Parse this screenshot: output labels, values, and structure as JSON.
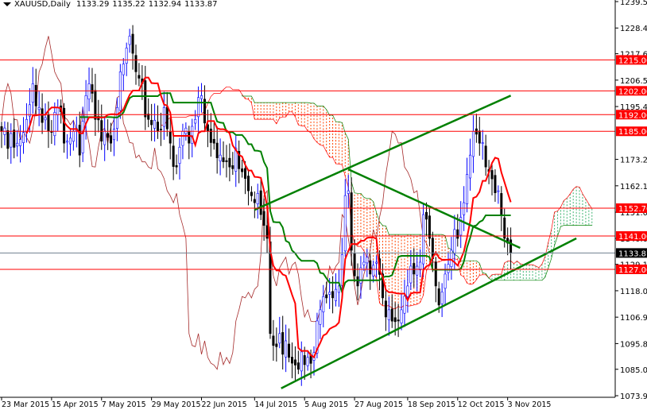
{
  "header": {
    "symbol": "XAUUSD,Daily",
    "open": "1133.29",
    "high": "1135.22",
    "low": "1132.94",
    "close": "1133.87"
  },
  "chart_data": {
    "type": "candlestick",
    "title": "XAUUSD,Daily",
    "ylim": [
      1073.9,
      1239.5
    ],
    "y_ticks": [
      "1239.50",
      "1228.40",
      "1217.60",
      "1206.50",
      "1195.40",
      "1173.20",
      "1162.10",
      "1151.00",
      "1140.00",
      "1129.10",
      "1118.00",
      "1106.90",
      "1095.80",
      "1085.00",
      "1073.90"
    ],
    "x_ticks": [
      {
        "bar": 0,
        "label": "23 Mar 2015"
      },
      {
        "bar": 16,
        "label": "15 Apr 2015"
      },
      {
        "bar": 32,
        "label": "7 May 2015"
      },
      {
        "bar": 48,
        "label": "29 May 2015"
      },
      {
        "bar": 64,
        "label": "22 Jun 2015"
      },
      {
        "bar": 81,
        "label": "14 Jul 2015"
      },
      {
        "bar": 97,
        "label": "5 Aug 2015"
      },
      {
        "bar": 113,
        "label": "27 Aug 2015"
      },
      {
        "bar": 130,
        "label": "18 Sep 2015"
      },
      {
        "bar": 146,
        "label": "12 Oct 2015"
      },
      {
        "bar": 162,
        "label": "3 Nov 2015"
      }
    ],
    "price_keypoints": [
      [
        0,
        1185
      ],
      [
        5,
        1180
      ],
      [
        8,
        1190
      ],
      [
        10,
        1205
      ],
      [
        12,
        1195
      ],
      [
        15,
        1185
      ],
      [
        18,
        1195
      ],
      [
        20,
        1180
      ],
      [
        23,
        1185
      ],
      [
        25,
        1175
      ],
      [
        27,
        1200
      ],
      [
        28,
        1205
      ],
      [
        30,
        1190
      ],
      [
        33,
        1185
      ],
      [
        35,
        1180
      ],
      [
        37,
        1195
      ],
      [
        38,
        1210
      ],
      [
        40,
        1220
      ],
      [
        41,
        1225
      ],
      [
        43,
        1210
      ],
      [
        45,
        1205
      ],
      [
        47,
        1190
      ],
      [
        50,
        1185
      ],
      [
        52,
        1195
      ],
      [
        54,
        1180
      ],
      [
        56,
        1170
      ],
      [
        58,
        1185
      ],
      [
        60,
        1180
      ],
      [
        62,
        1190
      ],
      [
        64,
        1200
      ],
      [
        66,
        1185
      ],
      [
        68,
        1180
      ],
      [
        70,
        1175
      ],
      [
        73,
        1170
      ],
      [
        75,
        1178
      ],
      [
        77,
        1168
      ],
      [
        79,
        1160
      ],
      [
        81,
        1155
      ],
      [
        83,
        1150
      ],
      [
        85,
        1140
      ],
      [
        86,
        1100
      ],
      [
        87,
        1095
      ],
      [
        89,
        1100
      ],
      [
        92,
        1090
      ],
      [
        95,
        1085
      ],
      [
        98,
        1090
      ],
      [
        100,
        1092
      ],
      [
        102,
        1110
      ],
      [
        104,
        1115
      ],
      [
        106,
        1115
      ],
      [
        108,
        1120
      ],
      [
        110,
        1158
      ],
      [
        111,
        1160
      ],
      [
        112,
        1135
      ],
      [
        114,
        1120
      ],
      [
        116,
        1130
      ],
      [
        118,
        1125
      ],
      [
        120,
        1130
      ],
      [
        122,
        1115
      ],
      [
        124,
        1110
      ],
      [
        126,
        1105
      ],
      [
        128,
        1110
      ],
      [
        130,
        1120
      ],
      [
        132,
        1125
      ],
      [
        134,
        1130
      ],
      [
        135,
        1150
      ],
      [
        137,
        1140
      ],
      [
        139,
        1120
      ],
      [
        140,
        1112
      ],
      [
        142,
        1125
      ],
      [
        144,
        1135
      ],
      [
        146,
        1140
      ],
      [
        148,
        1155
      ],
      [
        150,
        1175
      ],
      [
        151,
        1185
      ],
      [
        153,
        1180
      ],
      [
        155,
        1170
      ],
      [
        157,
        1165
      ],
      [
        159,
        1160
      ],
      [
        160,
        1150
      ],
      [
        161,
        1140
      ],
      [
        162,
        1138
      ],
      [
        163,
        1133.87
      ]
    ],
    "indicators": [
      "Ichimoku Tenkan-sen (9)",
      "Kijun-sen (26)",
      "Senkou Span A/B (52)",
      "Chikou Span"
    ],
    "levels": [
      {
        "price": 1215.0,
        "label": "1215.00"
      },
      {
        "price": 1202.0,
        "label": "1202.00"
      },
      {
        "price": 1192.0,
        "label": "1192.00"
      },
      {
        "price": 1185.0,
        "label": "1185.00"
      },
      {
        "price": 1152.7,
        "label": "1152.70"
      },
      {
        "price": 1141.0,
        "label": "1141.00"
      },
      {
        "price": 1127.0,
        "label": "1127.00"
      }
    ],
    "current_price": {
      "price": 1133.87,
      "label": "1133.87"
    },
    "trendlines": [
      {
        "name": "lower-support-trendline",
        "from": [
          89.5,
          1077
        ],
        "to": [
          184,
          1140
        ]
      },
      {
        "name": "upper-channel-trendline",
        "from": [
          81,
          1152
        ],
        "to": [
          163,
          1200
        ]
      },
      {
        "name": "descending-trendline",
        "from": [
          111,
          1169
        ],
        "to": [
          166,
          1136
        ]
      }
    ],
    "colors": {
      "bull": "#0000ff",
      "bear": "#000000",
      "tenkan": "#ff0000",
      "kijun": "#008000",
      "chikou": "#a52a2a",
      "cloud_bear": "#ff4500",
      "cloud_bull": "#3cb371",
      "level": "#ff0000",
      "trend": "#008000",
      "current": "#708090"
    }
  }
}
